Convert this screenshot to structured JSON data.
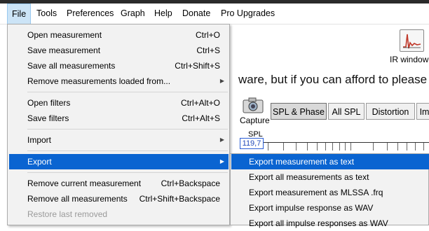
{
  "menubar": {
    "items": [
      {
        "label": "File",
        "active": true
      },
      {
        "label": "Tools"
      },
      {
        "label": "Preferences"
      },
      {
        "label": "Graph"
      },
      {
        "label": "Help"
      },
      {
        "label": "Donate"
      },
      {
        "label": "Pro Upgrades"
      }
    ]
  },
  "background": {
    "ir_windows_label": "IR window",
    "banner_text": "ware, but if you can afford to please",
    "capture_label": "Capture",
    "tabs": [
      "SPL & Phase",
      "All SPL",
      "Distortion",
      "Imp"
    ],
    "selected_tab": "SPL & Phase",
    "spl_label": "SPL",
    "spl_value": "119,7"
  },
  "file_menu": {
    "items": [
      {
        "label": "Open measurement",
        "shortcut": "Ctrl+O"
      },
      {
        "label": "Save measurement",
        "shortcut": "Ctrl+S"
      },
      {
        "label": "Save all measurements",
        "shortcut": "Ctrl+Shift+S"
      },
      {
        "label": "Remove measurements loaded from...",
        "submenu": true
      },
      {
        "label": "Open filters",
        "shortcut": "Ctrl+Alt+O"
      },
      {
        "label": "Save filters",
        "shortcut": "Ctrl+Alt+S"
      },
      {
        "label": "Import",
        "submenu": true
      },
      {
        "label": "Export",
        "submenu": true,
        "highlighted": true
      },
      {
        "label": "Remove current measurement",
        "shortcut": "Ctrl+Backspace"
      },
      {
        "label": "Remove all measurements",
        "shortcut": "Ctrl+Shift+Backspace"
      },
      {
        "label": "Restore last removed",
        "disabled": true
      }
    ]
  },
  "export_submenu": {
    "items": [
      {
        "label": "Export measurement as text",
        "highlighted": true
      },
      {
        "label": "Export all measurements as text"
      },
      {
        "label": "Export measurement as MLSSA .frq"
      },
      {
        "label": "Export impulse response as WAV"
      },
      {
        "label": "Export all impulse responses as WAV"
      }
    ]
  },
  "colors": {
    "highlight": "#0a64d1",
    "menu_bg": "#f2f2f2",
    "active_menubar": "#cce4f7",
    "spl_value": "#1f48b8"
  },
  "icons": {
    "arrow": "submenu-arrow-icon",
    "camera": "camera-icon",
    "ir": "ir-window-icon"
  }
}
